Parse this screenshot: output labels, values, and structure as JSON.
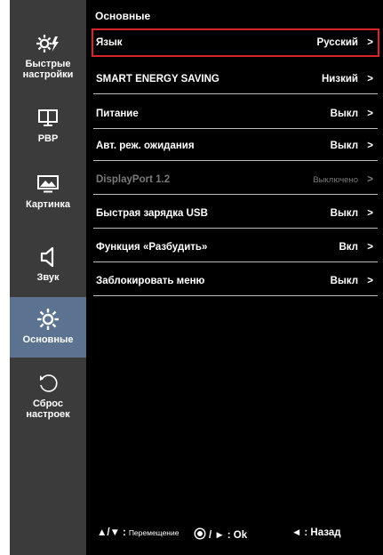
{
  "sidebar": {
    "items": [
      {
        "label_lines": [
          "Быстрые",
          "настройки"
        ],
        "icon": "quick-settings-icon"
      },
      {
        "label_lines": [
          "PBP"
        ],
        "icon": "pbp-icon"
      },
      {
        "label_lines": [
          "Картинка"
        ],
        "icon": "picture-icon"
      },
      {
        "label_lines": [
          "Звук"
        ],
        "icon": "speaker-icon"
      },
      {
        "label_lines": [
          "Основные"
        ],
        "icon": "gear-icon",
        "active": true
      },
      {
        "label_lines": [
          "Сброс",
          "настроек"
        ],
        "icon": "reset-icon"
      }
    ]
  },
  "main": {
    "title": "Основные",
    "rows": [
      {
        "label": "Язык",
        "value": "Русский",
        "arrow": ">",
        "selected": true
      },
      {
        "label": "SMART ENERGY SAVING",
        "value": "Низкий",
        "arrow": ">"
      },
      {
        "label": "Питание",
        "value": "Выкл",
        "arrow": ">"
      },
      {
        "label": "Авт. реж. ожидания",
        "value": "Выкл",
        "arrow": ">"
      },
      {
        "label": "DisplayPort 1.2",
        "value": "Выключено",
        "arrow": ">",
        "disabled": true
      },
      {
        "label": "Быстрая зарядка USB",
        "value": "Выкл",
        "arrow": ">"
      },
      {
        "label": "Функция «Разбудить»",
        "value": "Вкл",
        "arrow": ">"
      },
      {
        "label": "Заблокировать меню",
        "value": "Выкл",
        "arrow": ">"
      }
    ]
  },
  "footer": {
    "move_keys": "▲/▼",
    "move_label": "Перемещение",
    "ok_keys": "/ ►",
    "ok_label": ": Ok",
    "back_key": "◄",
    "back_label": ": Назад"
  },
  "colors": {
    "sidebar_bg": "#3b3b3b",
    "active_bg": "#5b7391",
    "selection_border": "#d6262b"
  }
}
